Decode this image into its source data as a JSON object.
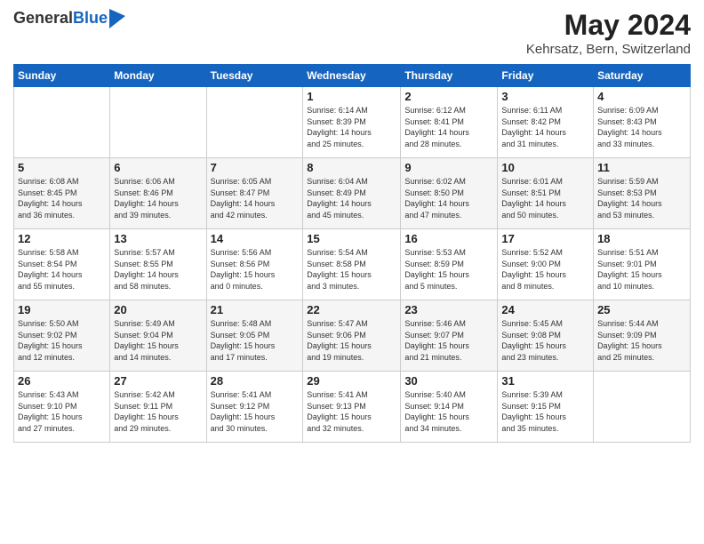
{
  "header": {
    "logo_general": "General",
    "logo_blue": "Blue",
    "title": "May 2024",
    "subtitle": "Kehrsatz, Bern, Switzerland"
  },
  "weekdays": [
    "Sunday",
    "Monday",
    "Tuesday",
    "Wednesday",
    "Thursday",
    "Friday",
    "Saturday"
  ],
  "weeks": [
    [
      {
        "day": "",
        "info": ""
      },
      {
        "day": "",
        "info": ""
      },
      {
        "day": "",
        "info": ""
      },
      {
        "day": "1",
        "info": "Sunrise: 6:14 AM\nSunset: 8:39 PM\nDaylight: 14 hours\nand 25 minutes."
      },
      {
        "day": "2",
        "info": "Sunrise: 6:12 AM\nSunset: 8:41 PM\nDaylight: 14 hours\nand 28 minutes."
      },
      {
        "day": "3",
        "info": "Sunrise: 6:11 AM\nSunset: 8:42 PM\nDaylight: 14 hours\nand 31 minutes."
      },
      {
        "day": "4",
        "info": "Sunrise: 6:09 AM\nSunset: 8:43 PM\nDaylight: 14 hours\nand 33 minutes."
      }
    ],
    [
      {
        "day": "5",
        "info": "Sunrise: 6:08 AM\nSunset: 8:45 PM\nDaylight: 14 hours\nand 36 minutes."
      },
      {
        "day": "6",
        "info": "Sunrise: 6:06 AM\nSunset: 8:46 PM\nDaylight: 14 hours\nand 39 minutes."
      },
      {
        "day": "7",
        "info": "Sunrise: 6:05 AM\nSunset: 8:47 PM\nDaylight: 14 hours\nand 42 minutes."
      },
      {
        "day": "8",
        "info": "Sunrise: 6:04 AM\nSunset: 8:49 PM\nDaylight: 14 hours\nand 45 minutes."
      },
      {
        "day": "9",
        "info": "Sunrise: 6:02 AM\nSunset: 8:50 PM\nDaylight: 14 hours\nand 47 minutes."
      },
      {
        "day": "10",
        "info": "Sunrise: 6:01 AM\nSunset: 8:51 PM\nDaylight: 14 hours\nand 50 minutes."
      },
      {
        "day": "11",
        "info": "Sunrise: 5:59 AM\nSunset: 8:53 PM\nDaylight: 14 hours\nand 53 minutes."
      }
    ],
    [
      {
        "day": "12",
        "info": "Sunrise: 5:58 AM\nSunset: 8:54 PM\nDaylight: 14 hours\nand 55 minutes."
      },
      {
        "day": "13",
        "info": "Sunrise: 5:57 AM\nSunset: 8:55 PM\nDaylight: 14 hours\nand 58 minutes."
      },
      {
        "day": "14",
        "info": "Sunrise: 5:56 AM\nSunset: 8:56 PM\nDaylight: 15 hours\nand 0 minutes."
      },
      {
        "day": "15",
        "info": "Sunrise: 5:54 AM\nSunset: 8:58 PM\nDaylight: 15 hours\nand 3 minutes."
      },
      {
        "day": "16",
        "info": "Sunrise: 5:53 AM\nSunset: 8:59 PM\nDaylight: 15 hours\nand 5 minutes."
      },
      {
        "day": "17",
        "info": "Sunrise: 5:52 AM\nSunset: 9:00 PM\nDaylight: 15 hours\nand 8 minutes."
      },
      {
        "day": "18",
        "info": "Sunrise: 5:51 AM\nSunset: 9:01 PM\nDaylight: 15 hours\nand 10 minutes."
      }
    ],
    [
      {
        "day": "19",
        "info": "Sunrise: 5:50 AM\nSunset: 9:02 PM\nDaylight: 15 hours\nand 12 minutes."
      },
      {
        "day": "20",
        "info": "Sunrise: 5:49 AM\nSunset: 9:04 PM\nDaylight: 15 hours\nand 14 minutes."
      },
      {
        "day": "21",
        "info": "Sunrise: 5:48 AM\nSunset: 9:05 PM\nDaylight: 15 hours\nand 17 minutes."
      },
      {
        "day": "22",
        "info": "Sunrise: 5:47 AM\nSunset: 9:06 PM\nDaylight: 15 hours\nand 19 minutes."
      },
      {
        "day": "23",
        "info": "Sunrise: 5:46 AM\nSunset: 9:07 PM\nDaylight: 15 hours\nand 21 minutes."
      },
      {
        "day": "24",
        "info": "Sunrise: 5:45 AM\nSunset: 9:08 PM\nDaylight: 15 hours\nand 23 minutes."
      },
      {
        "day": "25",
        "info": "Sunrise: 5:44 AM\nSunset: 9:09 PM\nDaylight: 15 hours\nand 25 minutes."
      }
    ],
    [
      {
        "day": "26",
        "info": "Sunrise: 5:43 AM\nSunset: 9:10 PM\nDaylight: 15 hours\nand 27 minutes."
      },
      {
        "day": "27",
        "info": "Sunrise: 5:42 AM\nSunset: 9:11 PM\nDaylight: 15 hours\nand 29 minutes."
      },
      {
        "day": "28",
        "info": "Sunrise: 5:41 AM\nSunset: 9:12 PM\nDaylight: 15 hours\nand 30 minutes."
      },
      {
        "day": "29",
        "info": "Sunrise: 5:41 AM\nSunset: 9:13 PM\nDaylight: 15 hours\nand 32 minutes."
      },
      {
        "day": "30",
        "info": "Sunrise: 5:40 AM\nSunset: 9:14 PM\nDaylight: 15 hours\nand 34 minutes."
      },
      {
        "day": "31",
        "info": "Sunrise: 5:39 AM\nSunset: 9:15 PM\nDaylight: 15 hours\nand 35 minutes."
      },
      {
        "day": "",
        "info": ""
      }
    ]
  ]
}
